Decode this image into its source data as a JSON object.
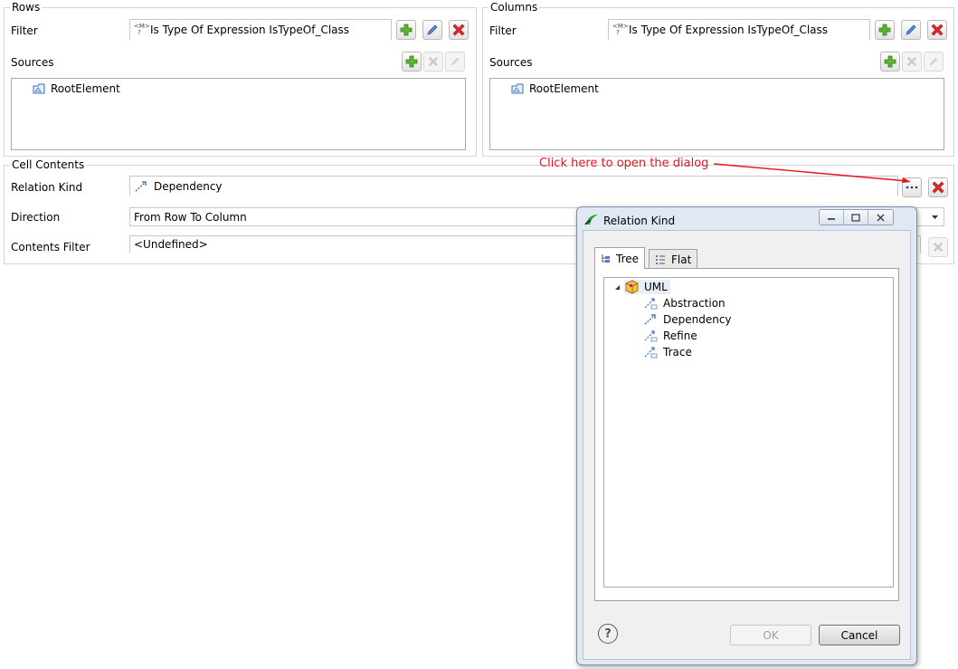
{
  "rows": {
    "title": "Rows",
    "filter_label": "Filter",
    "filter_value": "Is Type Of Expression IsTypeOf_Class",
    "sources_label": "Sources",
    "sources": [
      "RootElement"
    ]
  },
  "columns": {
    "title": "Columns",
    "filter_label": "Filter",
    "filter_value": "Is Type Of Expression IsTypeOf_Class",
    "sources_label": "Sources",
    "sources": [
      "RootElement"
    ]
  },
  "cell_contents": {
    "title": "Cell Contents",
    "relation_kind_label": "Relation Kind",
    "relation_kind_value": "Dependency",
    "direction_label": "Direction",
    "direction_value": "From Row To Column",
    "contents_filter_label": "Contents Filter",
    "contents_filter_value": "<Undefined>"
  },
  "annotation": {
    "text": "Click here to open the dialog",
    "color": "#e8141b"
  },
  "dialog": {
    "title": "Relation Kind",
    "tabs": [
      "Tree",
      "Flat"
    ],
    "active_tab": "Tree",
    "tree": {
      "root": "UML",
      "children": [
        "Abstraction",
        "Dependency",
        "Refine",
        "Trace"
      ]
    },
    "ok_label": "OK",
    "cancel_label": "Cancel"
  },
  "icons": {
    "add": "plus-icon",
    "edit": "pencil-icon",
    "delete": "red-x-icon",
    "browse": "ellipsis-icon",
    "help": "question-icon"
  }
}
